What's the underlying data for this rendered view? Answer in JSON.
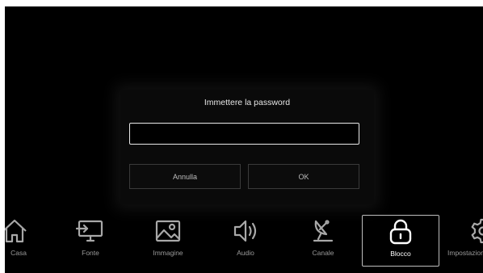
{
  "dialog": {
    "title": "Immettere la password",
    "password_value": "",
    "cancel_label": "Annulla",
    "ok_label": "OK"
  },
  "menu": {
    "items": [
      {
        "label": "Casa",
        "icon": "home-icon"
      },
      {
        "label": "Fonte",
        "icon": "source-icon"
      },
      {
        "label": "Immagine",
        "icon": "picture-icon"
      },
      {
        "label": "Audio",
        "icon": "speaker-icon"
      },
      {
        "label": "Canale",
        "icon": "satellite-dish-icon"
      },
      {
        "label": "Blocco",
        "icon": "lock-icon",
        "selected": true
      },
      {
        "label": "Impostazioni",
        "icon": "gear-icon"
      }
    ]
  },
  "colors": {
    "background": "#000000",
    "text": "#e6e6e6",
    "icon_inactive": "#a8a8a8",
    "icon_active": "#ffffff",
    "selection_border": "#bdbdbd"
  }
}
